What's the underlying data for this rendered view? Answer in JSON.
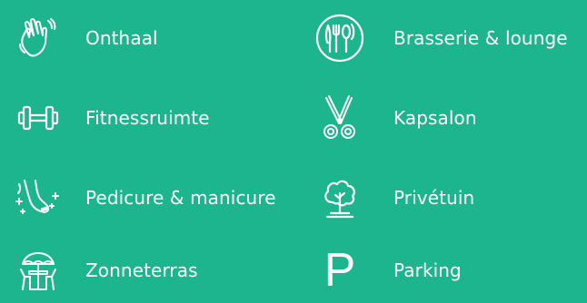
{
  "colors": {
    "background": "#1db58e",
    "foreground": "#ffffff"
  },
  "amenities_left": [
    {
      "label": "Onthaal",
      "icon": "waving-hand-icon"
    },
    {
      "label": "Fitnessruimte",
      "icon": "dumbbell-icon"
    },
    {
      "label": "Pedicure & manicure",
      "icon": "foot-sparkle-icon"
    },
    {
      "label": "Zonneterras",
      "icon": "sun-terrace-icon"
    }
  ],
  "amenities_right": [
    {
      "label": "Brasserie & lounge",
      "icon": "fork-spoon-plate-icon"
    },
    {
      "label": "Kapsalon",
      "icon": "scissors-icon"
    },
    {
      "label": "Privétuin",
      "icon": "tree-icon"
    },
    {
      "label": "Parking",
      "icon": "parking-icon",
      "glyph": "P"
    }
  ]
}
